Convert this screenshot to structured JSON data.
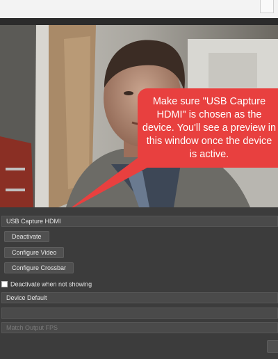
{
  "callout": {
    "text": "Make sure \"USB Capture HDMI\" is chosen as the device. You'll see a preview in this window once the device is active."
  },
  "device": {
    "selected": "USB Capture HDMI"
  },
  "buttons": {
    "deactivate": "Deactivate",
    "configure_video": "Configure Video",
    "configure_crossbar": "Configure Crossbar"
  },
  "checkbox": {
    "deactivate_when_not_showing": "Deactivate when not showing",
    "checked": false
  },
  "fields": {
    "resolution_type": "Device Default",
    "fps": "Match Output FPS"
  },
  "colors": {
    "callout": "#e8403f",
    "panel": "#3c3c3c"
  }
}
